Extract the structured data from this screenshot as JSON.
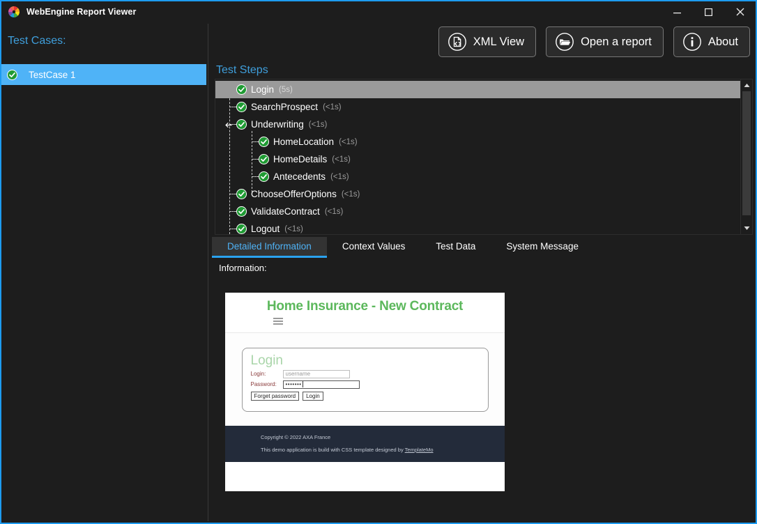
{
  "window": {
    "title": "WebEngine Report Viewer",
    "logo_icon": "color-wheel-icon",
    "controls": [
      {
        "name": "minimize",
        "icon": "minimize-icon"
      },
      {
        "name": "maximize",
        "icon": "maximize-icon"
      },
      {
        "name": "close",
        "icon": "close-icon"
      }
    ],
    "accent_color": "#1d9bf0",
    "background_color": "#1d1d1d"
  },
  "toolbar": {
    "buttons": [
      {
        "label": "XML View",
        "icon": "xml-document-icon"
      },
      {
        "label": "Open a report",
        "icon": "folder-open-icon"
      },
      {
        "label": "About",
        "icon": "info-circle-icon"
      }
    ]
  },
  "test_cases": {
    "label": "Test Cases:",
    "selected_index": 0,
    "items": [
      {
        "name": "TestCase 1",
        "status": "passed",
        "icon": "check-circle-icon"
      }
    ]
  },
  "test_steps": {
    "label": "Test Steps",
    "selected": "Login",
    "scrollbar": {
      "up_icon": "scroll-up-icon",
      "down_icon": "scroll-down-icon"
    },
    "nodes": [
      {
        "name": "Login",
        "duration": "(5s)",
        "level": 0,
        "status": "passed",
        "selected": true,
        "expander": false
      },
      {
        "name": "SearchProspect",
        "duration": "(<1s)",
        "level": 0,
        "status": "passed",
        "selected": false,
        "expander": false
      },
      {
        "name": "Underwriting",
        "duration": "(<1s)",
        "level": 0,
        "status": "passed",
        "selected": false,
        "expander": true
      },
      {
        "name": "HomeLocation",
        "duration": "(<1s)",
        "level": 1,
        "status": "passed",
        "selected": false,
        "expander": false
      },
      {
        "name": "HomeDetails",
        "duration": "(<1s)",
        "level": 1,
        "status": "passed",
        "selected": false,
        "expander": false
      },
      {
        "name": "Antecedents",
        "duration": "(<1s)",
        "level": 1,
        "status": "passed",
        "selected": false,
        "expander": false
      },
      {
        "name": "ChooseOfferOptions",
        "duration": "(<1s)",
        "level": 0,
        "status": "passed",
        "selected": false,
        "expander": false
      },
      {
        "name": "ValidateContract",
        "duration": "(<1s)",
        "level": 0,
        "status": "passed",
        "selected": false,
        "expander": false
      },
      {
        "name": "Logout",
        "duration": "(<1s)",
        "level": 0,
        "status": "passed",
        "selected": false,
        "expander": false
      }
    ]
  },
  "tabs": {
    "active_index": 0,
    "items": [
      {
        "label": "Detailed Information"
      },
      {
        "label": "Context Values"
      },
      {
        "label": "Test Data"
      },
      {
        "label": "System Message"
      }
    ]
  },
  "detail": {
    "information_label": "Information:",
    "screenshot": {
      "page_title": "Home Insurance - New Contract",
      "menu_icon": "hamburger-menu-icon",
      "login_form": {
        "heading": "Login",
        "fields": [
          {
            "label": "Login:",
            "value": "username"
          },
          {
            "label": "Password:",
            "value": "•••••••"
          }
        ],
        "buttons": [
          {
            "label": "Forget password"
          },
          {
            "label": "Login"
          }
        ]
      },
      "footer": {
        "copyright": "Copyright © 2022 AXA France",
        "credit_prefix": "This demo application is build with CSS template designed by ",
        "credit_link": "TemplateMo"
      }
    }
  }
}
